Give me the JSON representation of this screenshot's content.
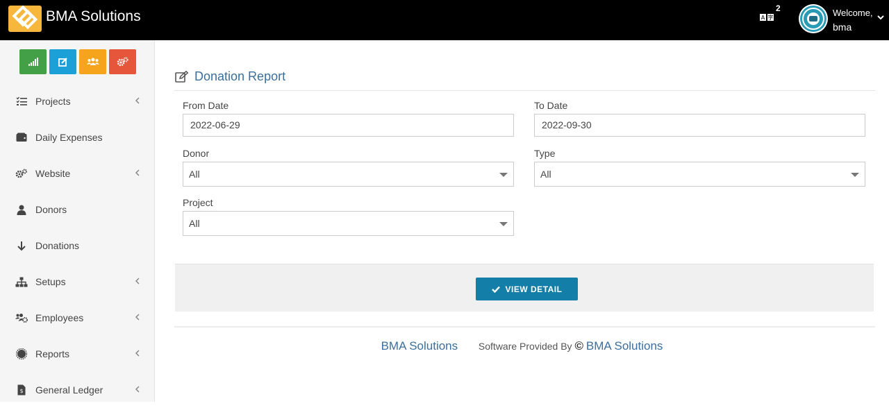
{
  "header": {
    "brand": "BMA Solutions",
    "notification_count": "2",
    "welcome": "Welcome,",
    "username": "bma"
  },
  "sidebar": {
    "quick_buttons": [
      {
        "icon": "signal-icon",
        "color": "#43a047"
      },
      {
        "icon": "edit-icon",
        "color": "#1ba1d8"
      },
      {
        "icon": "users-icon",
        "color": "#f7a41d"
      },
      {
        "icon": "cogs-icon",
        "color": "#e5563b"
      }
    ],
    "items": [
      {
        "label": "Projects",
        "icon": "list-icon",
        "has_submenu": true
      },
      {
        "label": "Daily Expenses",
        "icon": "wallet-icon",
        "has_submenu": false
      },
      {
        "label": "Website",
        "icon": "cogs-icon",
        "has_submenu": true
      },
      {
        "label": "Donors",
        "icon": "user-icon",
        "has_submenu": false
      },
      {
        "label": "Donations",
        "icon": "arrow-down-icon",
        "has_submenu": false
      },
      {
        "label": "Setups",
        "icon": "sitemap-icon",
        "has_submenu": true
      },
      {
        "label": "Employees",
        "icon": "users-cog-icon",
        "has_submenu": true
      },
      {
        "label": "Reports",
        "icon": "certificate-icon",
        "has_submenu": true
      },
      {
        "label": "General Ledger",
        "icon": "file-invoice-icon",
        "has_submenu": true
      }
    ]
  },
  "page": {
    "title": "Donation Report",
    "from_date": {
      "label": "From Date",
      "value": "2022-06-29"
    },
    "to_date": {
      "label": "To Date",
      "value": "2022-09-30"
    },
    "donor": {
      "label": "Donor",
      "value": "All"
    },
    "type": {
      "label": "Type",
      "value": "All"
    },
    "project": {
      "label": "Project",
      "value": "All"
    },
    "view_button": "VIEW DETAIL"
  },
  "footer": {
    "brand": "BMA Solutions",
    "provided_by": "Software Provided By",
    "copyright_symbol": "©",
    "company": "BMA Solutions"
  },
  "colors": {
    "topbar": "#000000",
    "accent": "#137fa8",
    "title": "#3a6fa0",
    "logo": "#f6b73c"
  }
}
